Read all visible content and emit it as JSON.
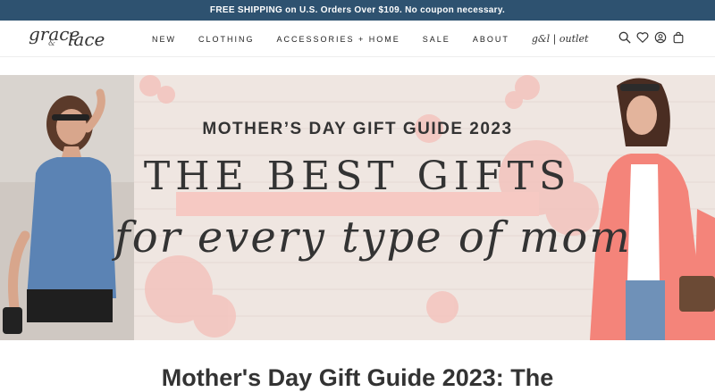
{
  "promo": {
    "text": "FREE SHIPPING on U.S. Orders Over $109. No coupon necessary."
  },
  "brand": {
    "grace": "grace",
    "amp": "&",
    "lace": "lace"
  },
  "nav": {
    "items": [
      "NEW",
      "CLOTHING",
      "ACCESSORIES + HOME",
      "SALE",
      "ABOUT"
    ],
    "outlet": "g&l | outlet"
  },
  "header_icons": [
    "search-icon",
    "heart-icon",
    "account-icon",
    "bag-icon"
  ],
  "hero": {
    "pill": "MOTHER’S DAY GIFT GUIDE 2023",
    "headline": "THE BEST GIFTS",
    "script": "for every type of mom"
  },
  "article": {
    "title": "Mother's Day Gift Guide 2023: The"
  },
  "colors": {
    "promo_bg": "#2e5270",
    "pill_bg": "#f6c9c3",
    "hero_bg": "#f0e8e4"
  }
}
